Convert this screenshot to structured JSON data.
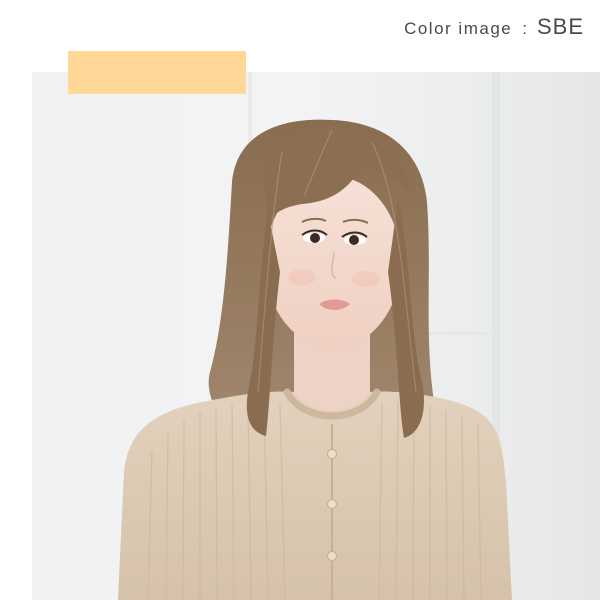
{
  "caption": {
    "label": "Color image",
    "separator": ":",
    "code": "SBE"
  },
  "swatch": {
    "color": "#FFD898"
  },
  "photo": {
    "subject": "model-wearing-wig",
    "hair_color": "#8E7458",
    "sweater_color": "#DCC8B0"
  }
}
